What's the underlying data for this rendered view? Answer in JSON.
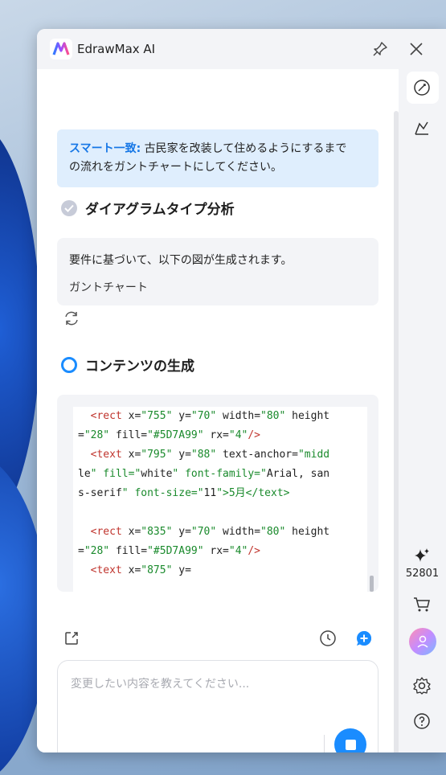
{
  "window": {
    "title": "EdrawMax AI"
  },
  "user_message": {
    "tag": "スマート一致:",
    "text_line1": "古民家を改装して住めるようにするまで",
    "text_line2": "の流れをガントチャートにしてください。"
  },
  "analysis": {
    "heading": "ダイアグラムタイプ分析",
    "description": "要件に基づいて、以下の図が生成されます。",
    "result": "ガントチャート"
  },
  "generation": {
    "heading": "コンテンツの生成"
  },
  "code_lines": [
    "  <rect x=\"755\" y=\"70\" width=\"80\" height",
    "=\"28\" fill=\"#5D7A99\" rx=\"4\"/>",
    "  <text x=\"795\" y=\"88\" text-anchor=\"midd",
    "le\" fill=\"white\" font-family=\"Arial, san",
    "s-serif\" font-size=\"11\">5月</text>",
    "",
    "  <rect x=\"835\" y=\"70\" width=\"80\" height",
    "=\"28\" fill=\"#5D7A99\" rx=\"4\"/>",
    "  <text x=\"875\" y="
  ],
  "input": {
    "placeholder": "変更したい内容を教えてください..."
  },
  "rail": {
    "credits": "52801"
  },
  "colors": {
    "accent": "#1a8cff",
    "user_bubble": "#dfeefd",
    "tag": "#1677e6"
  }
}
